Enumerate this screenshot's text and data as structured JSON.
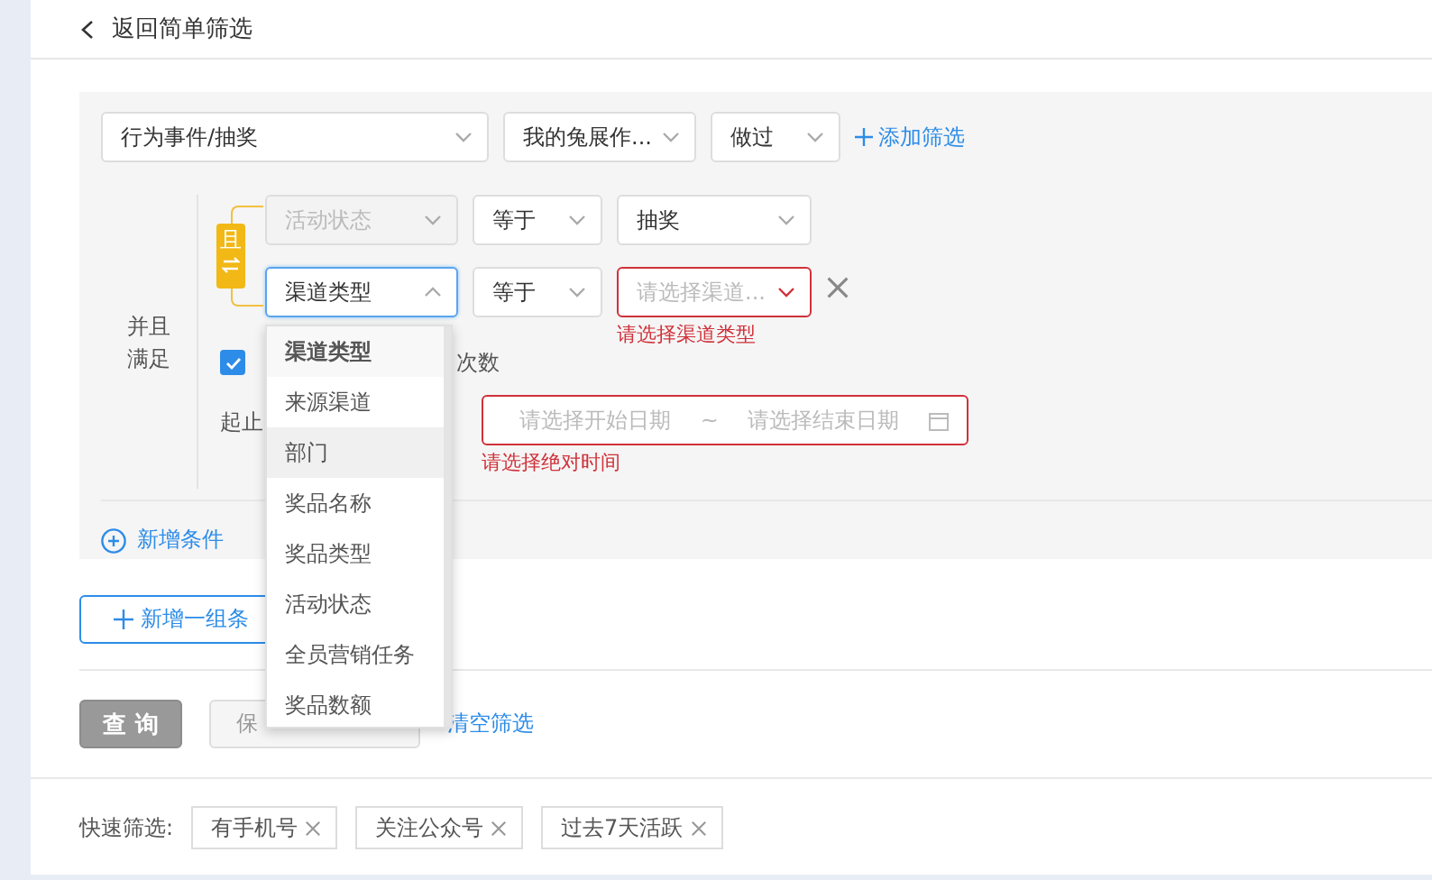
{
  "back_link": "返回简单筛选",
  "event_row": {
    "event": "行为事件/抽奖",
    "target": "我的兔展作...",
    "action": "做过",
    "add_filter": "添加筛选"
  },
  "group_label": "并且满足",
  "logic_badge": "且",
  "conditions": [
    {
      "field": "活动状态",
      "field_disabled": true,
      "field_open": false,
      "operator": "等于",
      "value": "抽奖",
      "value_placeholder": false,
      "error": false,
      "removable": false
    },
    {
      "field": "渠道类型",
      "field_disabled": false,
      "field_open": true,
      "operator": "等于",
      "value": "请选择渠道...",
      "value_placeholder": true,
      "error": true,
      "error_text": "请选择渠道类型",
      "removable": true
    }
  ],
  "count_row": {
    "checked": true,
    "label_end": "次数"
  },
  "date_row": {
    "label": "起止",
    "start_placeholder": "请选择开始日期",
    "separator": "~",
    "end_placeholder": "请选择结束日期",
    "error": true,
    "error_text": "请选择绝对时间"
  },
  "add_condition": "新增条件",
  "add_group": "新增一组条",
  "dropdown": [
    {
      "label": "渠道类型",
      "selected": true,
      "hovered": false
    },
    {
      "label": "来源渠道",
      "selected": false,
      "hovered": false
    },
    {
      "label": "部门",
      "selected": false,
      "hovered": true
    },
    {
      "label": "奖品名称",
      "selected": false,
      "hovered": false
    },
    {
      "label": "奖品类型",
      "selected": false,
      "hovered": false
    },
    {
      "label": "活动状态",
      "selected": false,
      "hovered": false
    },
    {
      "label": "全员营销任务",
      "selected": false,
      "hovered": false
    },
    {
      "label": "奖品数额",
      "selected": false,
      "hovered": false
    }
  ],
  "actions": {
    "query": "查 询",
    "save": "保",
    "clear": "清空筛选"
  },
  "quick_filters": {
    "label": "快速筛选:",
    "tags": [
      "有手机号",
      "关注公众号",
      "过去7天活跃"
    ]
  }
}
